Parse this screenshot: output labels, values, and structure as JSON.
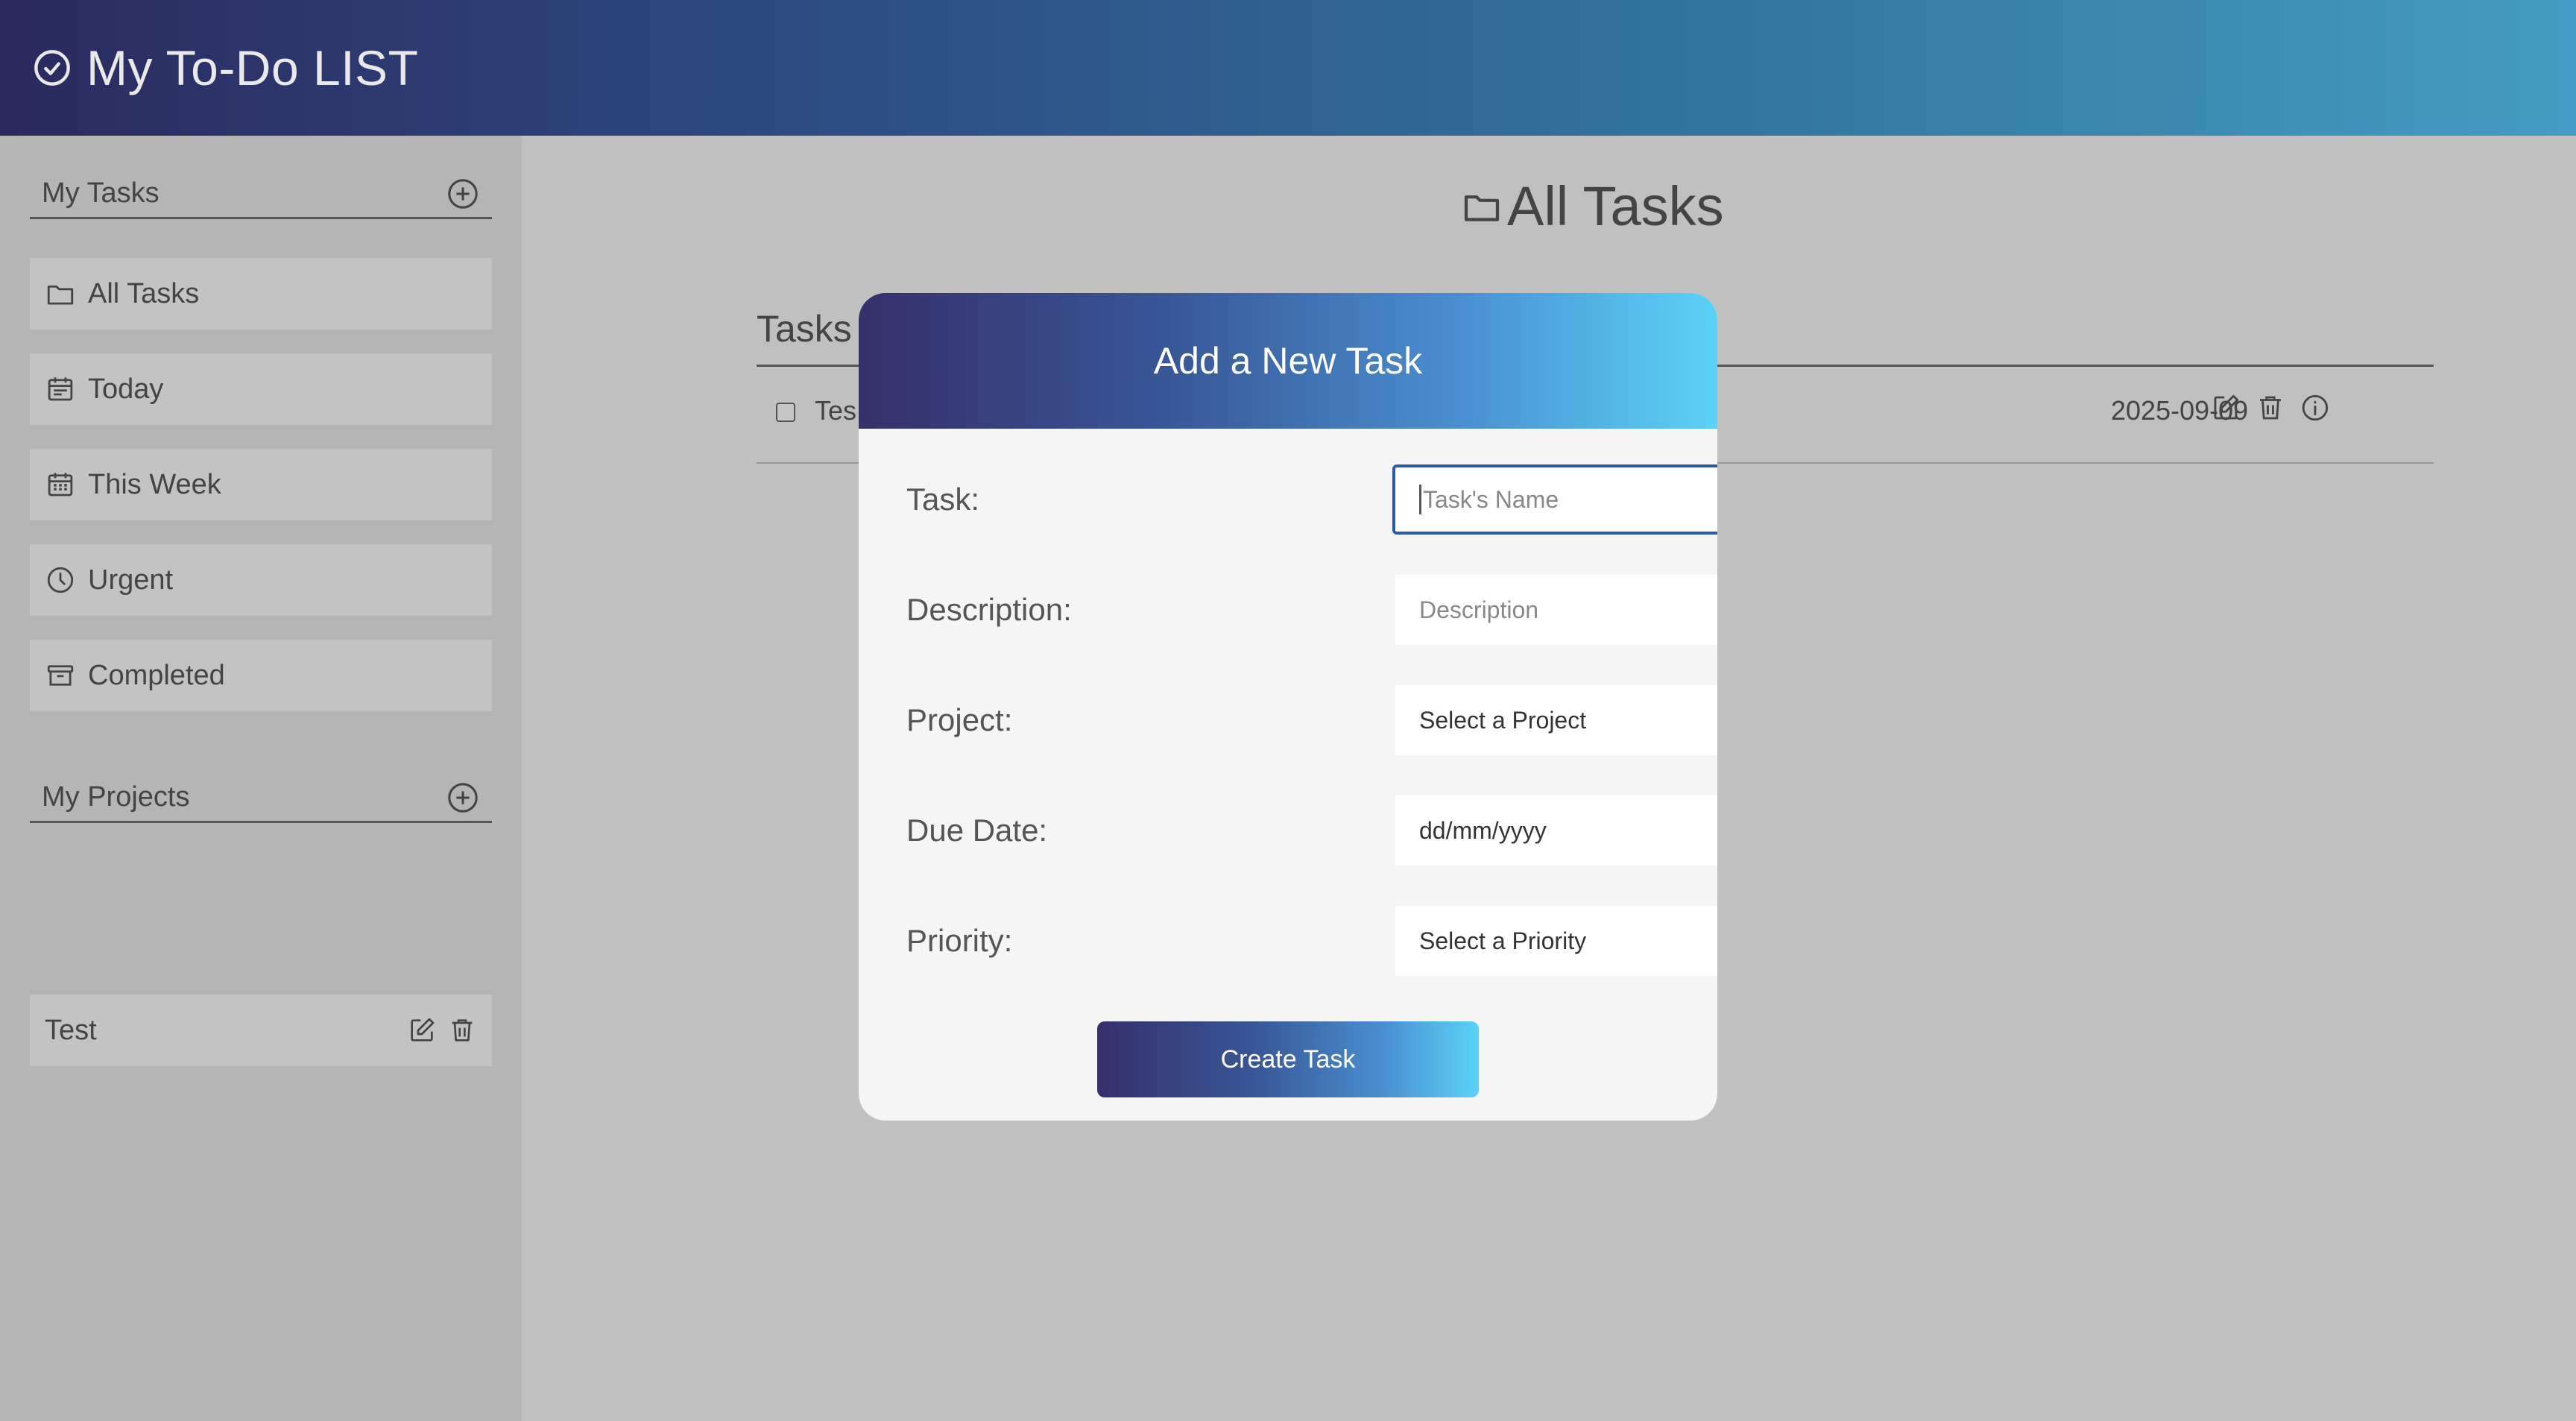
{
  "app": {
    "title": "My To-Do LIST"
  },
  "sidebar": {
    "my_tasks_header": "My Tasks",
    "items": [
      {
        "label": "All Tasks",
        "icon": "folder-icon"
      },
      {
        "label": "Today",
        "icon": "calendar-icon"
      },
      {
        "label": "This Week",
        "icon": "calendar-week-icon"
      },
      {
        "label": "Urgent",
        "icon": "clock-icon"
      },
      {
        "label": "Completed",
        "icon": "archive-icon"
      }
    ],
    "my_projects_header": "My Projects",
    "projects": [
      {
        "label": "Test"
      }
    ]
  },
  "main": {
    "page_title": "All Tasks",
    "tasks_heading": "Tasks",
    "tasks": [
      {
        "name": "Tes",
        "due": "2025-09-09"
      }
    ]
  },
  "modal": {
    "title": "Add a New Task",
    "fields": {
      "task_label": "Task:",
      "task_placeholder": "Task's Name",
      "description_label": "Description:",
      "description_placeholder": "Description",
      "project_label": "Project:",
      "project_value": "Select a Project",
      "due_label": "Due Date:",
      "due_value": "dd/mm/yyyy",
      "priority_label": "Priority:",
      "priority_value": "Select a Priority"
    },
    "create_button": "Create Task"
  },
  "colors": {
    "header_gradient_start": "#2b2a5e",
    "header_gradient_end": "#469cc4",
    "modal_gradient_start": "#36306b",
    "modal_gradient_end": "#5bd2f8",
    "focus_border": "#2b5aa8"
  }
}
